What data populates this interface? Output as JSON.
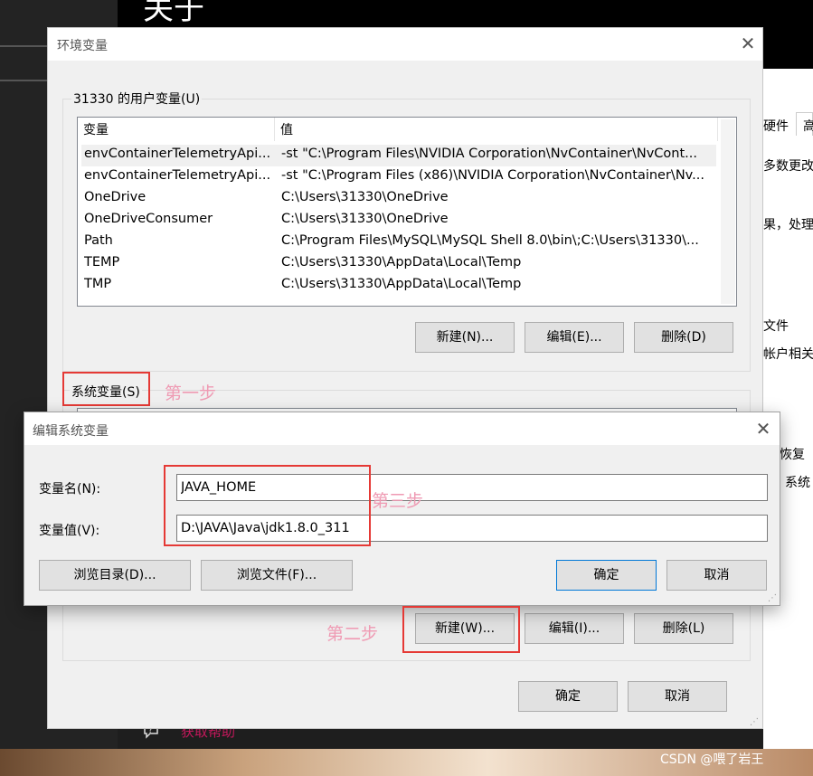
{
  "background_window": {
    "title": "关于",
    "right_texts": [
      "硬件",
      "高",
      "多数更改",
      "果，处理",
      "文件",
      "帐户相关",
      "恢复",
      "系统"
    ],
    "help_text": "获取帮助"
  },
  "env_dialog": {
    "title": "环境变量",
    "user_group_label": "31330 的用户变量(U)",
    "columns": [
      "变量",
      "值"
    ],
    "user_vars": [
      {
        "name": "envContainerTelemetryApi...",
        "value": "-st \"C:\\Program Files\\NVIDIA Corporation\\NvContainer\\NvCont..."
      },
      {
        "name": "envContainerTelemetryApi...",
        "value": "-st \"C:\\Program Files (x86)\\NVIDIA Corporation\\NvContainer\\Nv..."
      },
      {
        "name": "OneDrive",
        "value": "C:\\Users\\31330\\OneDrive"
      },
      {
        "name": "OneDriveConsumer",
        "value": "C:\\Users\\31330\\OneDrive"
      },
      {
        "name": "Path",
        "value": "C:\\Program Files\\MySQL\\MySQL Shell 8.0\\bin\\;C:\\Users\\31330\\..."
      },
      {
        "name": "TEMP",
        "value": "C:\\Users\\31330\\AppData\\Local\\Temp"
      },
      {
        "name": "TMP",
        "value": "C:\\Users\\31330\\AppData\\Local\\Temp"
      }
    ],
    "user_buttons": {
      "new": "新建(N)...",
      "edit": "编辑(E)...",
      "delete": "删除(D)"
    },
    "sys_group_label": "系统变量(S)",
    "sys_buttons": {
      "new": "新建(W)...",
      "edit": "编辑(I)...",
      "delete": "删除(L)"
    },
    "ok": "确定",
    "cancel": "取消"
  },
  "edit_dialog": {
    "title": "编辑系统变量",
    "name_label": "变量名(N):",
    "name_value": "JAVA_HOME",
    "value_label": "变量值(V):",
    "value_value": "D:\\JAVA\\Java\\jdk1.8.0_311",
    "browse_dir": "浏览目录(D)...",
    "browse_file": "浏览文件(F)...",
    "ok": "确定",
    "cancel": "取消"
  },
  "annotations": {
    "step1": "第一步",
    "step2": "第二步",
    "step3": "第三步"
  },
  "watermark": "CSDN @喂了岩王",
  "colors": {
    "annotation_red": "#e53935",
    "annotation_pink": "#ef9ab3",
    "accent": "#0078d7"
  }
}
